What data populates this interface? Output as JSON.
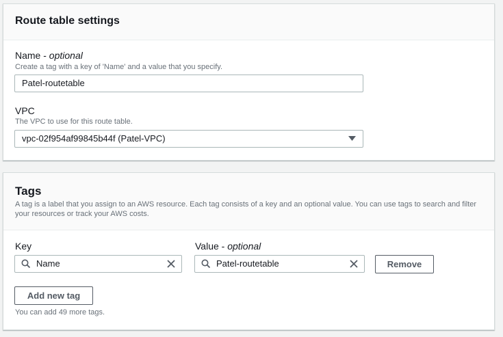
{
  "route_table_settings": {
    "title": "Route table settings",
    "name_label": "Name - ",
    "name_optional": "optional",
    "name_description": "Create a tag with a key of 'Name' and a value that you specify.",
    "name_value": "Patel-routetable",
    "vpc_label": "VPC",
    "vpc_description": "The VPC to use for this route table.",
    "vpc_selected": "vpc-02f954af99845b44f (Patel-VPC)"
  },
  "tags": {
    "title": "Tags",
    "description": "A tag is a label that you assign to an AWS resource. Each tag consists of a key and an optional value. You can use tags to search and filter your resources or track your AWS costs.",
    "key_label": "Key",
    "value_label": "Value - ",
    "value_optional": "optional",
    "rows": [
      {
        "key": "Name",
        "value": "Patel-routetable",
        "remove_label": "Remove"
      }
    ],
    "add_button_label": "Add new tag",
    "remaining_note": "You can add 49 more tags."
  },
  "icons": {
    "search": "search-icon",
    "clear": "close-icon",
    "dropdown": "caret-down-icon"
  },
  "colors": {
    "background": "#f2f3f3",
    "panel": "#ffffff",
    "header": "#fafafa",
    "text": "#16191f",
    "secondary_text": "#687078",
    "button_border": "#545b64"
  }
}
